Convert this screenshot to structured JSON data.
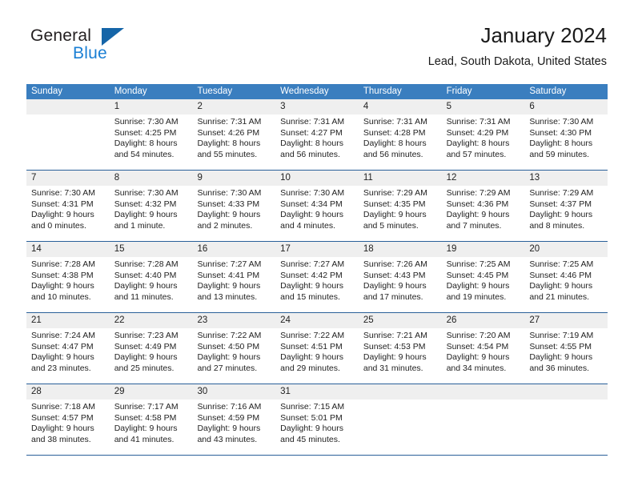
{
  "brand": {
    "name_top": "General",
    "name_bottom": "Blue",
    "triangle_color": "#1565a8",
    "blue_text_color": "#1a7fd4"
  },
  "header": {
    "month_title": "January 2024",
    "location": "Lead, South Dakota, United States"
  },
  "colors": {
    "header_band": "#3a7ebf",
    "daynum_band": "#efefef",
    "week_rule": "#2a6099",
    "text": "#222222"
  },
  "calendar": {
    "weekdays": [
      "Sunday",
      "Monday",
      "Tuesday",
      "Wednesday",
      "Thursday",
      "Friday",
      "Saturday"
    ],
    "weeks": [
      {
        "days": [
          {
            "num": "",
            "lines": []
          },
          {
            "num": "1",
            "lines": [
              "Sunrise: 7:30 AM",
              "Sunset: 4:25 PM",
              "Daylight: 8 hours",
              "and 54 minutes."
            ]
          },
          {
            "num": "2",
            "lines": [
              "Sunrise: 7:31 AM",
              "Sunset: 4:26 PM",
              "Daylight: 8 hours",
              "and 55 minutes."
            ]
          },
          {
            "num": "3",
            "lines": [
              "Sunrise: 7:31 AM",
              "Sunset: 4:27 PM",
              "Daylight: 8 hours",
              "and 56 minutes."
            ]
          },
          {
            "num": "4",
            "lines": [
              "Sunrise: 7:31 AM",
              "Sunset: 4:28 PM",
              "Daylight: 8 hours",
              "and 56 minutes."
            ]
          },
          {
            "num": "5",
            "lines": [
              "Sunrise: 7:31 AM",
              "Sunset: 4:29 PM",
              "Daylight: 8 hours",
              "and 57 minutes."
            ]
          },
          {
            "num": "6",
            "lines": [
              "Sunrise: 7:30 AM",
              "Sunset: 4:30 PM",
              "Daylight: 8 hours",
              "and 59 minutes."
            ]
          }
        ]
      },
      {
        "days": [
          {
            "num": "7",
            "lines": [
              "Sunrise: 7:30 AM",
              "Sunset: 4:31 PM",
              "Daylight: 9 hours",
              "and 0 minutes."
            ]
          },
          {
            "num": "8",
            "lines": [
              "Sunrise: 7:30 AM",
              "Sunset: 4:32 PM",
              "Daylight: 9 hours",
              "and 1 minute."
            ]
          },
          {
            "num": "9",
            "lines": [
              "Sunrise: 7:30 AM",
              "Sunset: 4:33 PM",
              "Daylight: 9 hours",
              "and 2 minutes."
            ]
          },
          {
            "num": "10",
            "lines": [
              "Sunrise: 7:30 AM",
              "Sunset: 4:34 PM",
              "Daylight: 9 hours",
              "and 4 minutes."
            ]
          },
          {
            "num": "11",
            "lines": [
              "Sunrise: 7:29 AM",
              "Sunset: 4:35 PM",
              "Daylight: 9 hours",
              "and 5 minutes."
            ]
          },
          {
            "num": "12",
            "lines": [
              "Sunrise: 7:29 AM",
              "Sunset: 4:36 PM",
              "Daylight: 9 hours",
              "and 7 minutes."
            ]
          },
          {
            "num": "13",
            "lines": [
              "Sunrise: 7:29 AM",
              "Sunset: 4:37 PM",
              "Daylight: 9 hours",
              "and 8 minutes."
            ]
          }
        ]
      },
      {
        "days": [
          {
            "num": "14",
            "lines": [
              "Sunrise: 7:28 AM",
              "Sunset: 4:38 PM",
              "Daylight: 9 hours",
              "and 10 minutes."
            ]
          },
          {
            "num": "15",
            "lines": [
              "Sunrise: 7:28 AM",
              "Sunset: 4:40 PM",
              "Daylight: 9 hours",
              "and 11 minutes."
            ]
          },
          {
            "num": "16",
            "lines": [
              "Sunrise: 7:27 AM",
              "Sunset: 4:41 PM",
              "Daylight: 9 hours",
              "and 13 minutes."
            ]
          },
          {
            "num": "17",
            "lines": [
              "Sunrise: 7:27 AM",
              "Sunset: 4:42 PM",
              "Daylight: 9 hours",
              "and 15 minutes."
            ]
          },
          {
            "num": "18",
            "lines": [
              "Sunrise: 7:26 AM",
              "Sunset: 4:43 PM",
              "Daylight: 9 hours",
              "and 17 minutes."
            ]
          },
          {
            "num": "19",
            "lines": [
              "Sunrise: 7:25 AM",
              "Sunset: 4:45 PM",
              "Daylight: 9 hours",
              "and 19 minutes."
            ]
          },
          {
            "num": "20",
            "lines": [
              "Sunrise: 7:25 AM",
              "Sunset: 4:46 PM",
              "Daylight: 9 hours",
              "and 21 minutes."
            ]
          }
        ]
      },
      {
        "days": [
          {
            "num": "21",
            "lines": [
              "Sunrise: 7:24 AM",
              "Sunset: 4:47 PM",
              "Daylight: 9 hours",
              "and 23 minutes."
            ]
          },
          {
            "num": "22",
            "lines": [
              "Sunrise: 7:23 AM",
              "Sunset: 4:49 PM",
              "Daylight: 9 hours",
              "and 25 minutes."
            ]
          },
          {
            "num": "23",
            "lines": [
              "Sunrise: 7:22 AM",
              "Sunset: 4:50 PM",
              "Daylight: 9 hours",
              "and 27 minutes."
            ]
          },
          {
            "num": "24",
            "lines": [
              "Sunrise: 7:22 AM",
              "Sunset: 4:51 PM",
              "Daylight: 9 hours",
              "and 29 minutes."
            ]
          },
          {
            "num": "25",
            "lines": [
              "Sunrise: 7:21 AM",
              "Sunset: 4:53 PM",
              "Daylight: 9 hours",
              "and 31 minutes."
            ]
          },
          {
            "num": "26",
            "lines": [
              "Sunrise: 7:20 AM",
              "Sunset: 4:54 PM",
              "Daylight: 9 hours",
              "and 34 minutes."
            ]
          },
          {
            "num": "27",
            "lines": [
              "Sunrise: 7:19 AM",
              "Sunset: 4:55 PM",
              "Daylight: 9 hours",
              "and 36 minutes."
            ]
          }
        ]
      },
      {
        "days": [
          {
            "num": "28",
            "lines": [
              "Sunrise: 7:18 AM",
              "Sunset: 4:57 PM",
              "Daylight: 9 hours",
              "and 38 minutes."
            ]
          },
          {
            "num": "29",
            "lines": [
              "Sunrise: 7:17 AM",
              "Sunset: 4:58 PM",
              "Daylight: 9 hours",
              "and 41 minutes."
            ]
          },
          {
            "num": "30",
            "lines": [
              "Sunrise: 7:16 AM",
              "Sunset: 4:59 PM",
              "Daylight: 9 hours",
              "and 43 minutes."
            ]
          },
          {
            "num": "31",
            "lines": [
              "Sunrise: 7:15 AM",
              "Sunset: 5:01 PM",
              "Daylight: 9 hours",
              "and 45 minutes."
            ]
          },
          {
            "num": "",
            "lines": []
          },
          {
            "num": "",
            "lines": []
          },
          {
            "num": "",
            "lines": []
          }
        ]
      }
    ]
  }
}
